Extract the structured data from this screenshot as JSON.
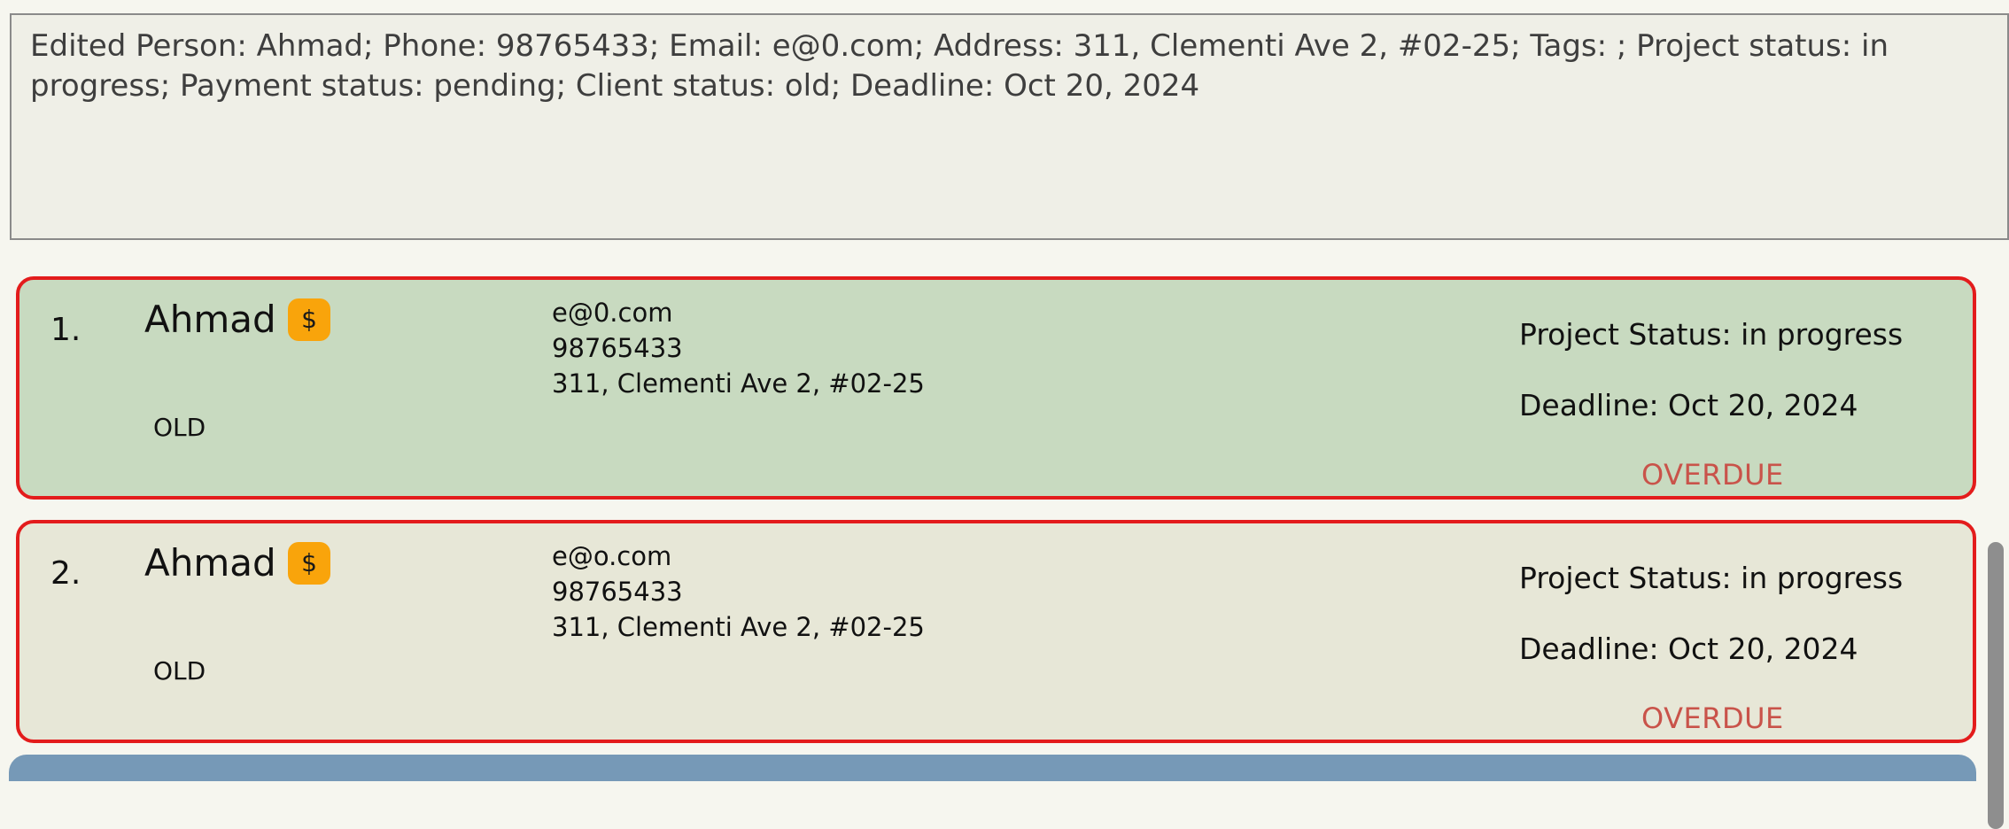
{
  "result_display": {
    "text": "Edited Person: Ahmad; Phone: 98765433; Email: e@0.com; Address: 311, Clementi Ave 2, #02-25; Tags: ; Project status: in progress; Payment status: pending; Client status: old; Deadline: Oct 20, 2024"
  },
  "persons": [
    {
      "index": "1.",
      "name": "Ahmad",
      "payment_badge": "$",
      "client_status": "OLD",
      "email": "e@0.com",
      "phone": "98765433",
      "address": "311, Clementi Ave 2, #02-25",
      "project_status": "Project Status: in progress",
      "deadline": "Deadline: Oct 20, 2024",
      "overdue": "OVERDUE"
    },
    {
      "index": "2.",
      "name": "Ahmad",
      "payment_badge": "$",
      "client_status": "OLD",
      "email": "e@o.com",
      "phone": "98765433",
      "address": "311, Clementi Ave 2, #02-25",
      "project_status": "Project Status: in progress",
      "deadline": "Deadline: Oct 20, 2024",
      "overdue": "OVERDUE"
    }
  ],
  "colors": {
    "selected_card_bg": "#c8dac0",
    "card_bg": "#e7e7d7",
    "card_border": "#e31c1c",
    "payment_badge": "#f9a40b",
    "overdue_text": "#c9534a",
    "next_card_peek": "#7699b7"
  }
}
